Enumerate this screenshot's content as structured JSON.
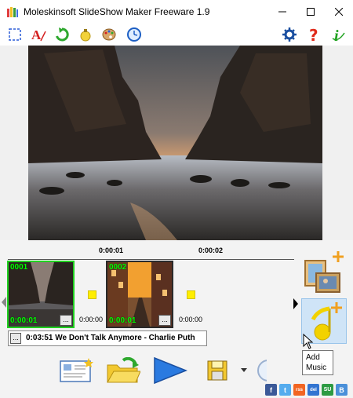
{
  "window": {
    "title": "Moleskinsoft SlideShow Maker Freeware 1.9",
    "controls": [
      "minimize-icon",
      "maximize-icon",
      "close-icon"
    ]
  },
  "toolbar": {
    "left_icons": [
      "select-icon",
      "text-icon",
      "rotate-icon",
      "effect-icon",
      "palette-icon",
      "clock-icon"
    ],
    "right_icons": [
      "settings-icon",
      "help-icon",
      "info-icon"
    ]
  },
  "timeline": {
    "ruler_labels": [
      "0:00:01",
      "0:00:02"
    ],
    "slides": [
      {
        "number": "0001",
        "duration": "0:00:01",
        "more": "...",
        "selected": true
      },
      {
        "number": "0002",
        "duration": "0:00:01",
        "more": "...",
        "selected": false
      }
    ],
    "transitions": [
      "0:00:00",
      "0:00:00"
    ],
    "music": {
      "button": "...",
      "track": "0:03:51 We Don't Talk Anymore - Charlie Puth"
    }
  },
  "side_buttons": {
    "add_photo_icon": "add-photo-icon",
    "add_music_icon": "add-music-icon"
  },
  "tooltip": {
    "text_line1": "Add",
    "text_line2": "Music"
  },
  "bottom_buttons": [
    "new-project-icon",
    "open-project-icon",
    "play-icon",
    "save-icon",
    "dropdown-icon"
  ],
  "social": [
    {
      "label": "f",
      "color": "#3b5998"
    },
    {
      "label": "t",
      "color": "#55acee"
    },
    {
      "label": "rss",
      "color": "#f26522"
    },
    {
      "label": "del",
      "color": "#3274d1"
    },
    {
      "label": "SU",
      "color": "#2d9b43"
    },
    {
      "label": "B",
      "color": "#4a90d9"
    }
  ],
  "colors": {
    "accent_green": "#00ff00",
    "transition_yellow": "#ffee00",
    "selection_green": "#1fd11f"
  }
}
